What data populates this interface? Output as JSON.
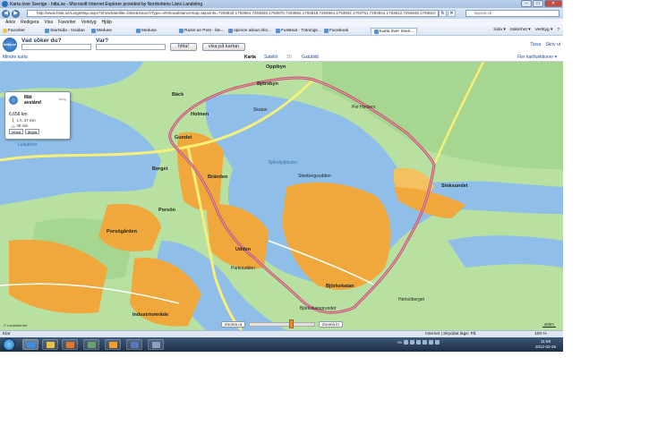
{
  "window": {
    "title": "Karta över Sverige - hitta.se - Microsoft Internet Explorer provided by Norrbottens Läns Landsting",
    "minimize": "–",
    "maximize": "□",
    "close": "✕"
  },
  "address": {
    "url": "http://www.hitta.se/LargeMap.aspx?ShowSatellite=false&SearchType=4#showdistancemap=t&points=7293840,1793964,7293828,1793870,7293852,1793818,7293904,1793802,1793751,7293844,1793812,7293848,1793810",
    "search_placeholder": "lapona.ck"
  },
  "menu": [
    "Arkiv",
    "Redigera",
    "Visa",
    "Favoriter",
    "Verktyg",
    "Hjälp"
  ],
  "favorites": {
    "label": "Favoriter",
    "items": [
      "Startsida - Insidan",
      "Meduse",
      "Meduse",
      "Razer.se Post - län...",
      "opinion about drin...",
      "FunBeat - Tränings...",
      "Facebook",
      "Karta över Sveri..."
    ],
    "tools": [
      "Sida ▾",
      "Säkerhet ▾",
      "Verktyg ▾",
      "?"
    ]
  },
  "hitta": {
    "logo": "hitta.se",
    "what_label": "Vad söker du?",
    "where_label": "Var?",
    "search_button": "hitta!",
    "show_map_button": "visa på kartan",
    "links": [
      "Tipsa",
      "Skriv ut"
    ]
  },
  "map_toolbar": {
    "small_map": "Mindre karta",
    "views": [
      "Karta",
      "Satellit",
      "3D",
      "Gatubild"
    ],
    "more_functions": "Fler kartfunktioner ▾"
  },
  "measure": {
    "title": "Mät avstånd",
    "close": "stäng",
    "distance": "6,656 km",
    "walk": "1 h, 37 min",
    "bike": "29 min",
    "buttons": [
      "rensa",
      "ångra"
    ]
  },
  "map_labels": {
    "oppibyn": "Oppibyn",
    "bjorsbyn": "Björsbyn",
    "back": "Bäck",
    "holmen": "Holmen",
    "gundet": "Gundet",
    "berget": "Berget",
    "branden": "Bränden",
    "porson": "Porsön",
    "porsogarden": "Porsögården",
    "udden": "Udden",
    "bjorkskatan": "Björkskatan",
    "industriomrade": "Industriområde",
    "sinksundet": "Sinksundet",
    "bjorsbyfjarden": "Björsbyfjärden",
    "skatan": "Skatan",
    "per_hinders": "Per Hinders",
    "stenbergsudden": "Stenbergsudden",
    "parkoudden": "Parkoudden",
    "bjorkskatagrundet": "Björkskatagrundet",
    "hertsoberget": "Hertsöberget",
    "lulealv": "Luleälven"
  },
  "zoom": {
    "out": "Zooma ut",
    "in": "Zooma in"
  },
  "scale": "400m",
  "copyright": "© Lantmäteriet",
  "status": {
    "left": "Klar",
    "zone": "Internet | Skyddat läge: På",
    "zoom": "100 %"
  },
  "taskbar": {
    "lang": "SV",
    "time": "11:59",
    "date": "2012-02-26"
  },
  "colors": {
    "water": "#8fbfe8",
    "land": "#b8e0a0",
    "residential": "#f0a83c",
    "route": "#c0566e",
    "road": "#f6f07a"
  }
}
